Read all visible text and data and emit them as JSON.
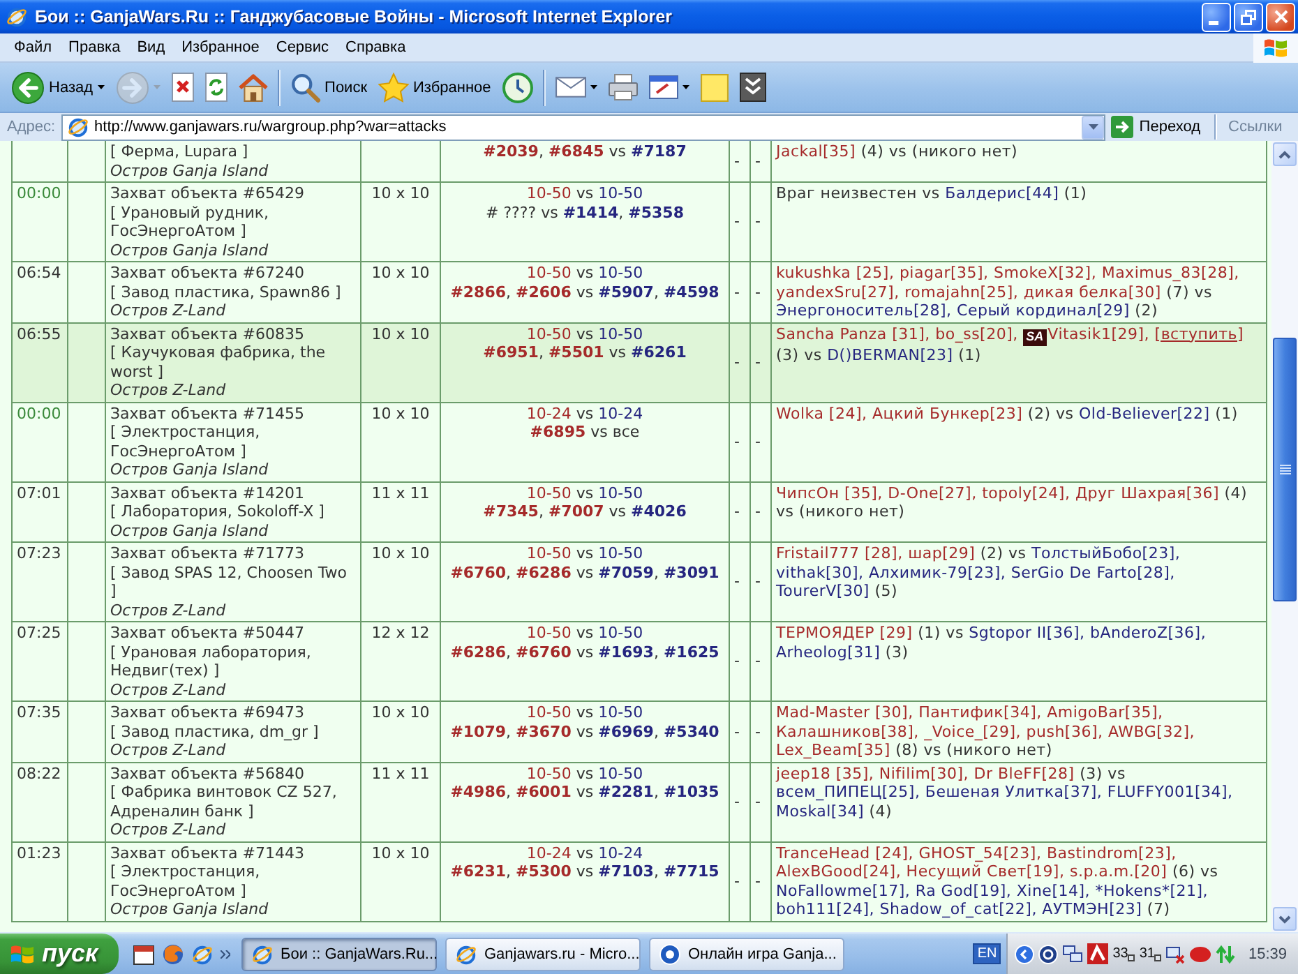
{
  "window": {
    "title": "Бои :: GanjaWars.Ru :: Ганджубасовые Войны - Microsoft Internet Explorer"
  },
  "menu": [
    "Файл",
    "Правка",
    "Вид",
    "Избранное",
    "Сервис",
    "Справка"
  ],
  "toolbar": [
    {
      "kind": "back",
      "label": "Назад",
      "dropdown": true,
      "disabled": false
    },
    {
      "kind": "forward",
      "dropdown": true,
      "disabled": true
    },
    {
      "kind": "stop",
      "dropdown": false,
      "disabled": false
    },
    {
      "kind": "refresh",
      "dropdown": false,
      "disabled": false
    },
    {
      "kind": "home",
      "dropdown": false,
      "disabled": false
    },
    {
      "kind": "separator"
    },
    {
      "kind": "search",
      "label": "Поиск",
      "dropdown": false,
      "disabled": false
    },
    {
      "kind": "favorites",
      "label": "Избранное",
      "dropdown": false,
      "disabled": false
    },
    {
      "kind": "history",
      "dropdown": false,
      "disabled": false
    },
    {
      "kind": "separator"
    },
    {
      "kind": "mail",
      "dropdown": true,
      "disabled": false
    },
    {
      "kind": "print",
      "dropdown": false,
      "disabled": false
    },
    {
      "kind": "edit",
      "dropdown": true,
      "disabled": false
    },
    {
      "kind": "note",
      "dropdown": false,
      "disabled": false
    },
    {
      "kind": "tool",
      "dropdown": false,
      "disabled": false
    }
  ],
  "address_bar": {
    "label": "Адрес:",
    "url": "http://www.ganjawars.ru/wargroup.php?war=attacks",
    "go_label": "Переход",
    "links_label": "Ссылки"
  },
  "table": {
    "rows": [
      {
        "highlighted": false,
        "location": "[ Ферма, Lupara ]",
        "island": "Остров Ganja Island",
        "ids": [
          {
            "text": "#2039",
            "color": "#a52a2a"
          },
          {
            "text": ", "
          },
          {
            "text": "#6845",
            "color": "#a52a2a"
          },
          {
            "text": " vs "
          },
          {
            "text": "#7187",
            "color": "#25257f"
          }
        ],
        "column_6": "-",
        "column_7": "-",
        "participants": [
          {
            "kind": "text",
            "text": "Jackal[35]",
            "color": "#a52a2a"
          },
          {
            "kind": "text",
            "text": " (4) vs (никого нет)"
          }
        ]
      },
      {
        "highlighted": false,
        "time": "00:00",
        "time_highlighted": true,
        "title": "Захват объекта #65429",
        "location": "[ Урановый рудник, ГосЭнергоАтом ]",
        "island": "Остров Ganja Island",
        "size": "10 x 10",
        "levels": [
          {
            "text": "10-50",
            "color": "#a52a2a"
          },
          {
            "text": " vs "
          },
          {
            "text": "10-50",
            "color": "#25257f"
          }
        ],
        "ids": [
          {
            "text": "# ????"
          },
          {
            "text": " vs "
          },
          {
            "text": "#1414",
            "color": "#25257f"
          },
          {
            "text": ", "
          },
          {
            "text": "#5358",
            "color": "#25257f"
          }
        ],
        "column_6": "-",
        "column_7": "-",
        "participants": [
          {
            "kind": "text",
            "text": "Враг неизвестен vs "
          },
          {
            "kind": "text",
            "text": "Балдерис[44]",
            "color": "#25257f"
          },
          {
            "kind": "text",
            "text": " (1)"
          }
        ]
      },
      {
        "highlighted": false,
        "time": "06:54",
        "time_highlighted": false,
        "title": "Захват объекта #67240",
        "location": "[ Завод пластика, Spawn86 ]",
        "island": "Остров Z-Land",
        "size": "10 x 10",
        "levels": [
          {
            "text": "10-50",
            "color": "#a52a2a"
          },
          {
            "text": " vs "
          },
          {
            "text": "10-50",
            "color": "#25257f"
          }
        ],
        "ids": [
          {
            "text": "#2866",
            "color": "#a52a2a"
          },
          {
            "text": ", "
          },
          {
            "text": "#2606",
            "color": "#a52a2a"
          },
          {
            "text": " vs "
          },
          {
            "text": "#5907",
            "color": "#25257f"
          },
          {
            "text": ", "
          },
          {
            "text": "#4598",
            "color": "#25257f"
          }
        ],
        "column_6": "-",
        "column_7": "-",
        "participants": [
          {
            "kind": "text",
            "text": "kukushka [25], piagar[35], SmokeX[32], Maximus_83[28], yandexSru[27], romajahn[25], дикая белка[30]",
            "color": "#a52a2a"
          },
          {
            "kind": "text",
            "text": " (7) vs "
          },
          {
            "kind": "text",
            "text": "Энергоноситель[28], Серый кординал[29]",
            "color": "#25257f"
          },
          {
            "kind": "text",
            "text": " (2)"
          }
        ]
      },
      {
        "highlighted": true,
        "time": "06:55",
        "time_highlighted": false,
        "title": "Захват объекта #60835",
        "location": "[ Каучуковая фабрика, the worst ]",
        "island": "Остров Z-Land",
        "size": "10 x 10",
        "levels": [
          {
            "text": "10-50",
            "color": "#a52a2a"
          },
          {
            "text": " vs "
          },
          {
            "text": "10-50",
            "color": "#25257f"
          }
        ],
        "ids": [
          {
            "text": "#6951",
            "color": "#a52a2a"
          },
          {
            "text": ", "
          },
          {
            "text": "#5501",
            "color": "#a52a2a"
          },
          {
            "text": " vs "
          },
          {
            "text": "#6261",
            "color": "#25257f"
          }
        ],
        "column_6": "-",
        "column_7": "-",
        "participants": [
          {
            "kind": "text",
            "text": "Sancha Panza [31], bo_ss[20], ",
            "color": "#a52a2a"
          },
          {
            "kind": "emblem",
            "text": "SA"
          },
          {
            "kind": "text",
            "text": "Vitasik1[29], ",
            "color": "#a52a2a"
          },
          {
            "kind": "link",
            "text": "[вступить]",
            "color": "#a52a2a"
          },
          {
            "kind": "text",
            "text": " (3) vs "
          },
          {
            "kind": "text",
            "text": "D()BERMAN[23]",
            "color": "#25257f"
          },
          {
            "kind": "text",
            "text": " (1)"
          }
        ]
      },
      {
        "highlighted": false,
        "time": "00:00",
        "time_highlighted": true,
        "title": "Захват объекта #71455",
        "location": "[ Электростанция, ГосЭнергоАтом ]",
        "island": "Остров Ganja Island",
        "size": "10 x 10",
        "levels": [
          {
            "text": "10-24",
            "color": "#a52a2a"
          },
          {
            "text": " vs "
          },
          {
            "text": "10-24",
            "color": "#25257f"
          }
        ],
        "ids": [
          {
            "text": "#6895",
            "color": "#a52a2a"
          },
          {
            "text": " vs все"
          }
        ],
        "column_6": "-",
        "column_7": "-",
        "participants": [
          {
            "kind": "text",
            "text": "Wolka [24], Ацкий Бункер[23]",
            "color": "#a52a2a"
          },
          {
            "kind": "text",
            "text": " (2) vs "
          },
          {
            "kind": "text",
            "text": "Old-Believer[22]",
            "color": "#25257f"
          },
          {
            "kind": "text",
            "text": " (1)"
          }
        ]
      },
      {
        "highlighted": false,
        "time": "07:01",
        "time_highlighted": false,
        "title": "Захват объекта #14201",
        "location": "[ Лаборатория, Sokoloff-X ]",
        "island": "Остров Ganja Island",
        "size": "11 x 11",
        "levels": [
          {
            "text": "10-50",
            "color": "#a52a2a"
          },
          {
            "text": " vs "
          },
          {
            "text": "10-50",
            "color": "#25257f"
          }
        ],
        "ids": [
          {
            "text": "#7345",
            "color": "#a52a2a"
          },
          {
            "text": ", "
          },
          {
            "text": "#7007",
            "color": "#a52a2a"
          },
          {
            "text": " vs "
          },
          {
            "text": "#4026",
            "color": "#25257f"
          }
        ],
        "column_6": "-",
        "column_7": "-",
        "participants": [
          {
            "kind": "text",
            "text": "ЧипсОн [35], D-One[27], topoly[24], Друг Шахрая[36]",
            "color": "#a52a2a"
          },
          {
            "kind": "text",
            "text": " (4) vs (никого нет)"
          }
        ]
      },
      {
        "highlighted": false,
        "time": "07:23",
        "time_highlighted": false,
        "title": "Захват объекта #71773",
        "location": "[ Завод SPAS 12, Choosen Two ]",
        "island": "Остров Z-Land",
        "size": "10 x 10",
        "levels": [
          {
            "text": "10-50",
            "color": "#a52a2a"
          },
          {
            "text": " vs "
          },
          {
            "text": "10-50",
            "color": "#25257f"
          }
        ],
        "ids": [
          {
            "text": "#6760",
            "color": "#a52a2a"
          },
          {
            "text": ", "
          },
          {
            "text": "#6286",
            "color": "#a52a2a"
          },
          {
            "text": " vs "
          },
          {
            "text": "#7059",
            "color": "#25257f"
          },
          {
            "text": ", "
          },
          {
            "text": "#3091",
            "color": "#25257f"
          }
        ],
        "column_6": "-",
        "column_7": "-",
        "participants": [
          {
            "kind": "text",
            "text": "Fristail777 [28], шар[29]",
            "color": "#a52a2a"
          },
          {
            "kind": "text",
            "text": " (2) vs "
          },
          {
            "kind": "text",
            "text": "ТолстыйБобо[23], vithak[30], Алхимик-79[23], SerGio De Farto[28], TourerV[30]",
            "color": "#25257f"
          },
          {
            "kind": "text",
            "text": " (5)"
          }
        ]
      },
      {
        "highlighted": false,
        "time": "07:25",
        "time_highlighted": false,
        "title": "Захват объекта #50447",
        "location": "[ Урановая лаборатория, Недвиг(тех) ]",
        "island": "Остров Z-Land",
        "size": "12 x 12",
        "levels": [
          {
            "text": "10-50",
            "color": "#a52a2a"
          },
          {
            "text": " vs "
          },
          {
            "text": "10-50",
            "color": "#25257f"
          }
        ],
        "ids": [
          {
            "text": "#6286",
            "color": "#a52a2a"
          },
          {
            "text": ", "
          },
          {
            "text": "#6760",
            "color": "#a52a2a"
          },
          {
            "text": " vs "
          },
          {
            "text": "#1693",
            "color": "#25257f"
          },
          {
            "text": ", "
          },
          {
            "text": "#1625",
            "color": "#25257f"
          }
        ],
        "column_6": "-",
        "column_7": "-",
        "participants": [
          {
            "kind": "text",
            "text": "ТЕРМОЯДЕР [29]",
            "color": "#a52a2a"
          },
          {
            "kind": "text",
            "text": " (1) vs "
          },
          {
            "kind": "text",
            "text": "Sgtopor II[36], bAnderoZ[36], Arheolog[31]",
            "color": "#25257f"
          },
          {
            "kind": "text",
            "text": " (3)"
          }
        ]
      },
      {
        "highlighted": false,
        "time": "07:35",
        "time_highlighted": false,
        "title": "Захват объекта #69473",
        "location": "[ Завод пластика, dm_gr ]",
        "island": "Остров Z-Land",
        "size": "10 x 10",
        "levels": [
          {
            "text": "10-50",
            "color": "#a52a2a"
          },
          {
            "text": " vs "
          },
          {
            "text": "10-50",
            "color": "#25257f"
          }
        ],
        "ids": [
          {
            "text": "#1079",
            "color": "#a52a2a"
          },
          {
            "text": ", "
          },
          {
            "text": "#3670",
            "color": "#a52a2a"
          },
          {
            "text": " vs "
          },
          {
            "text": "#6969",
            "color": "#25257f"
          },
          {
            "text": ", "
          },
          {
            "text": "#5340",
            "color": "#25257f"
          }
        ],
        "column_6": "-",
        "column_7": "-",
        "participants": [
          {
            "kind": "text",
            "text": "Mad-Master [30], Пантифик[34], AmigoBar[35], Калашников[38], _Voice_[29], push[36], AWBG[32], Lex_Beam[35]",
            "color": "#a52a2a"
          },
          {
            "kind": "text",
            "text": " (8) vs (никого нет)"
          }
        ]
      },
      {
        "highlighted": false,
        "time": "08:22",
        "time_highlighted": false,
        "title": "Захват объекта #56840",
        "location": "[ Фабрика винтовок CZ 527, Адреналин банк ]",
        "island": "Остров Z-Land",
        "size": "11 x 11",
        "levels": [
          {
            "text": "10-50",
            "color": "#a52a2a"
          },
          {
            "text": " vs "
          },
          {
            "text": "10-50",
            "color": "#25257f"
          }
        ],
        "ids": [
          {
            "text": "#4986",
            "color": "#a52a2a"
          },
          {
            "text": ", "
          },
          {
            "text": "#6001",
            "color": "#a52a2a"
          },
          {
            "text": " vs "
          },
          {
            "text": "#2281",
            "color": "#25257f"
          },
          {
            "text": ", "
          },
          {
            "text": "#1035",
            "color": "#25257f"
          }
        ],
        "column_6": "-",
        "column_7": "-",
        "participants": [
          {
            "kind": "text",
            "text": "jeep18 [35], Nifilim[30], Dr BleFF[28]",
            "color": "#a52a2a"
          },
          {
            "kind": "text",
            "text": " (3) vs "
          },
          {
            "kind": "text",
            "text": "всем_ПИПЕЦ[25], Бешеная Улитка[37], FLUFFY001[34], Moskal[34]",
            "color": "#25257f"
          },
          {
            "kind": "text",
            "text": " (4)"
          }
        ]
      },
      {
        "highlighted": false,
        "time": "01:23",
        "time_highlighted": false,
        "title": "Захват объекта #71443",
        "location": "[ Электростанция, ГосЭнергоАтом ]",
        "island": "Остров Ganja Island",
        "size": "10 x 10",
        "levels": [
          {
            "text": "10-24",
            "color": "#a52a2a"
          },
          {
            "text": " vs "
          },
          {
            "text": "10-24",
            "color": "#25257f"
          }
        ],
        "ids": [
          {
            "text": "#6231",
            "color": "#a52a2a"
          },
          {
            "text": ", "
          },
          {
            "text": "#5300",
            "color": "#a52a2a"
          },
          {
            "text": " vs "
          },
          {
            "text": "#7103",
            "color": "#25257f"
          },
          {
            "text": ", "
          },
          {
            "text": "#7715",
            "color": "#25257f"
          }
        ],
        "column_6": "-",
        "column_7": "-",
        "participants": [
          {
            "kind": "text",
            "text": "TranceHead [24], GHOST_54[23], Bastindrom[23], AlexBGood[24], Несущий Свет[19], s.p.a.m.[20]",
            "color": "#a52a2a"
          },
          {
            "kind": "text",
            "text": " (6) vs "
          },
          {
            "kind": "text",
            "text": "NoFallowme[17], Ra God[19], Xine[14], *Hokens*[21], boh111[24], Shadow_of_cat[22], АУТМЭН[23]",
            "color": "#25257f"
          },
          {
            "kind": "text",
            "text": " (7)"
          }
        ]
      }
    ]
  },
  "taskbar": {
    "start_label": "пуск",
    "tasks": [
      {
        "kind": "browser",
        "label": "Бои :: GanjaWars.Ru...",
        "selected": true
      },
      {
        "kind": "browser",
        "label": "Ganjawars.ru - Micro...",
        "selected": false
      },
      {
        "kind": "app",
        "label": "Онлайн игра Ganja...",
        "selected": false
      }
    ],
    "language": "EN",
    "tray_texts": [
      "33",
      "31"
    ],
    "clock": "15:39"
  }
}
